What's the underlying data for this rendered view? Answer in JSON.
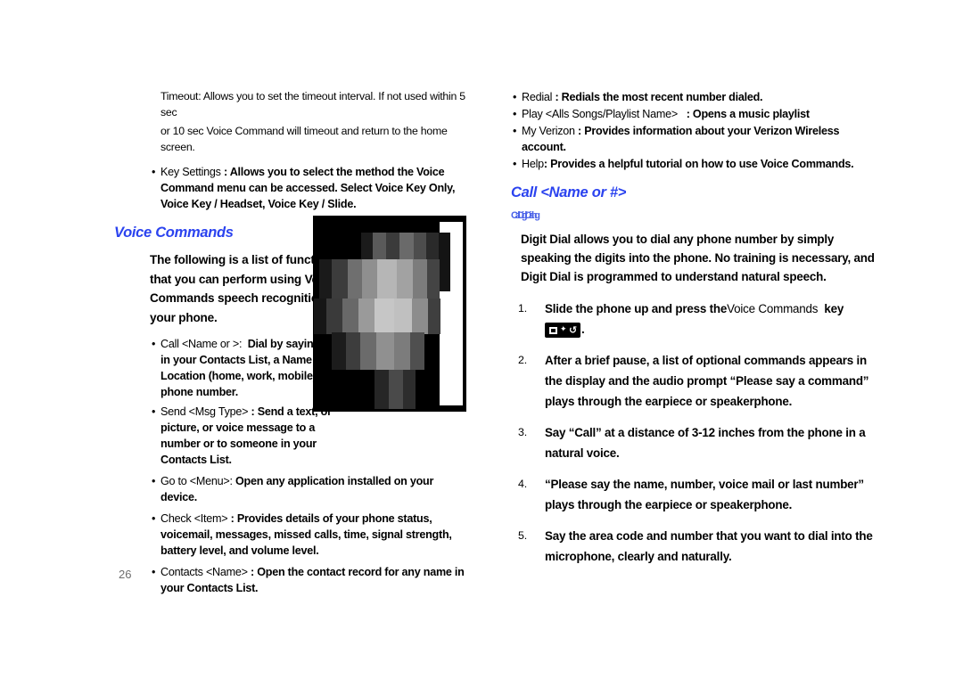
{
  "page": {
    "number": "26",
    "background": "#ffffff",
    "heading_color": "#2b43ef",
    "subheading_color": "#4a62e8"
  },
  "left_column": {
    "timeout_note_line1": "Timeout: Allows you to set the timeout interval. If not used within 5 sec",
    "timeout_note_line2": "or 10 sec Voice Command will timeout and return to the home screen.",
    "key_settings_bullet": {
      "term": "Key Settings",
      "desc": ": Allows you to select the method the Voice Command menu can be accessed. Select Voice Key Only, Voice Key / Headset, Voice Key / Slide."
    },
    "section_heading": "Voice Commands",
    "intro": "The following is a list of functions that you can perform using Voice Commands speech recognition on your phone.",
    "bullets": [
      {
        "term": "Call <Name or >:",
        "desc": "Dial by saying a Name in your Contacts List, a Name and a Location (home, work, mobile), or the phone number."
      },
      {
        "term": "Send <Msg Type>",
        "desc": ": Send a text, or picture, or voice message to a number or to someone in your Contacts List."
      },
      {
        "term": "Go to <Menu>:",
        "desc": "Open any application installed on your device."
      },
      {
        "term": "Check <Item>",
        "desc": ": Provides details of your phone status, voicemail, messages, missed calls, time, signal strength, battery level, and volume level."
      },
      {
        "term": "Contacts <Name>",
        "desc": ": Open the contact record for any name in your Contacts List."
      }
    ]
  },
  "right_column": {
    "bullets": [
      {
        "term": "Redial",
        "desc": ": Redials the most recent number dialed."
      },
      {
        "term": "Play <Alls Songs/Playlist Name>",
        "desc": ": Opens a music playlist"
      },
      {
        "term": "My Verizon",
        "desc": ": Provides information about your Verizon Wireless account."
      },
      {
        "term": "Help",
        "desc": ": Provides a helpful tutorial on how to use Voice Commands."
      }
    ],
    "section_heading": "Call <Name or #>",
    "sub_heading": "Call Digit Dialing",
    "intro": "Digit Dial allows you to dial any phone number by simply speaking the digits into the phone. No training is necessary, and Digit Dial is programmed to understand natural speech.",
    "steps": [
      {
        "num": "1.",
        "pre": "Slide the phone up and press the",
        "regular": "Voice Commands",
        "post": "key",
        "icon": "voice-commands-key-icon",
        "trailing": "."
      },
      {
        "num": "2.",
        "text": "After a brief pause, a list of optional commands appears in the display and the audio prompt “Please say a command” plays through the earpiece or speakerphone."
      },
      {
        "num": "3.",
        "text": "Say “Call” at a distance of 3-12 inches from the phone in a natural voice."
      },
      {
        "num": "4.",
        "text": "“Please say the name, number, voice mail or last number” plays through the earpiece or speakerphone."
      },
      {
        "num": "5.",
        "text": "Say the area code and number that you want to dial into the microphone, clearly and naturally."
      }
    ]
  },
  "figure": {
    "caption": "",
    "alt_name": "pixelated-phone-illustration"
  }
}
